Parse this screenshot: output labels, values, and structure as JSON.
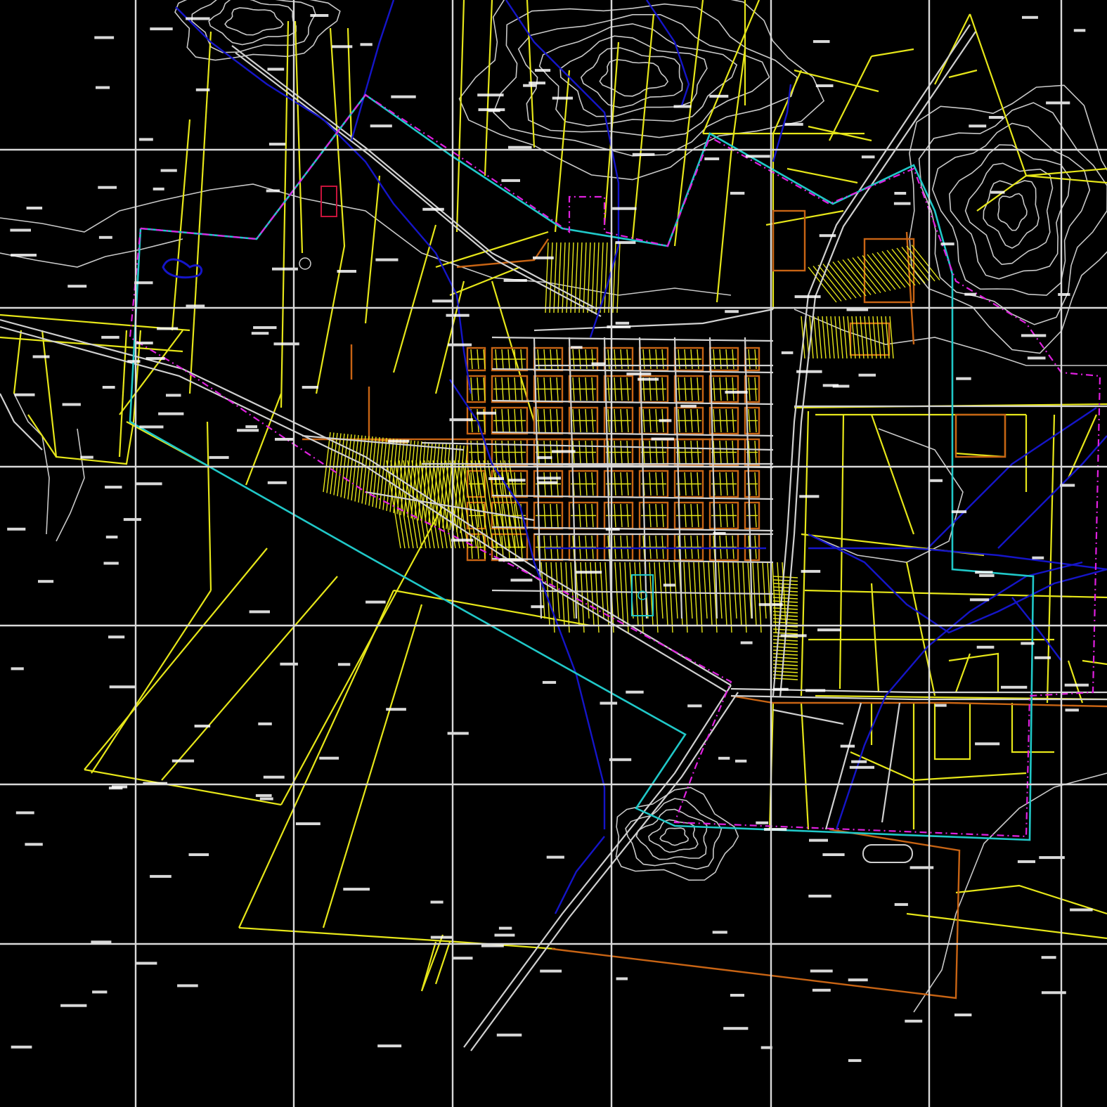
{
  "view": {
    "title": "",
    "background": "#000000"
  },
  "colors": {
    "grid": "#d9d9d9",
    "parcel": "#e6e619",
    "road": "#d0d0d0",
    "contour": "#c8c8c8",
    "river": "#1515c8",
    "urban_limit": "#20c8c8",
    "admin_boundary": "#e020e0",
    "block": "#c86414",
    "label": "#ffffff",
    "sports_field": "#20c8c8"
  },
  "layers": [
    {
      "name": "grid",
      "icon": "grid-icon"
    },
    {
      "name": "parcels",
      "icon": "parcel-icon"
    },
    {
      "name": "roads",
      "icon": "road-icon"
    },
    {
      "name": "contours",
      "icon": "contour-icon"
    },
    {
      "name": "rivers",
      "icon": "river-icon"
    },
    {
      "name": "urban-limit",
      "icon": "boundary-icon"
    },
    {
      "name": "admin-boundary",
      "icon": "boundary-icon"
    },
    {
      "name": "blocks",
      "icon": "block-icon"
    }
  ],
  "labels": []
}
